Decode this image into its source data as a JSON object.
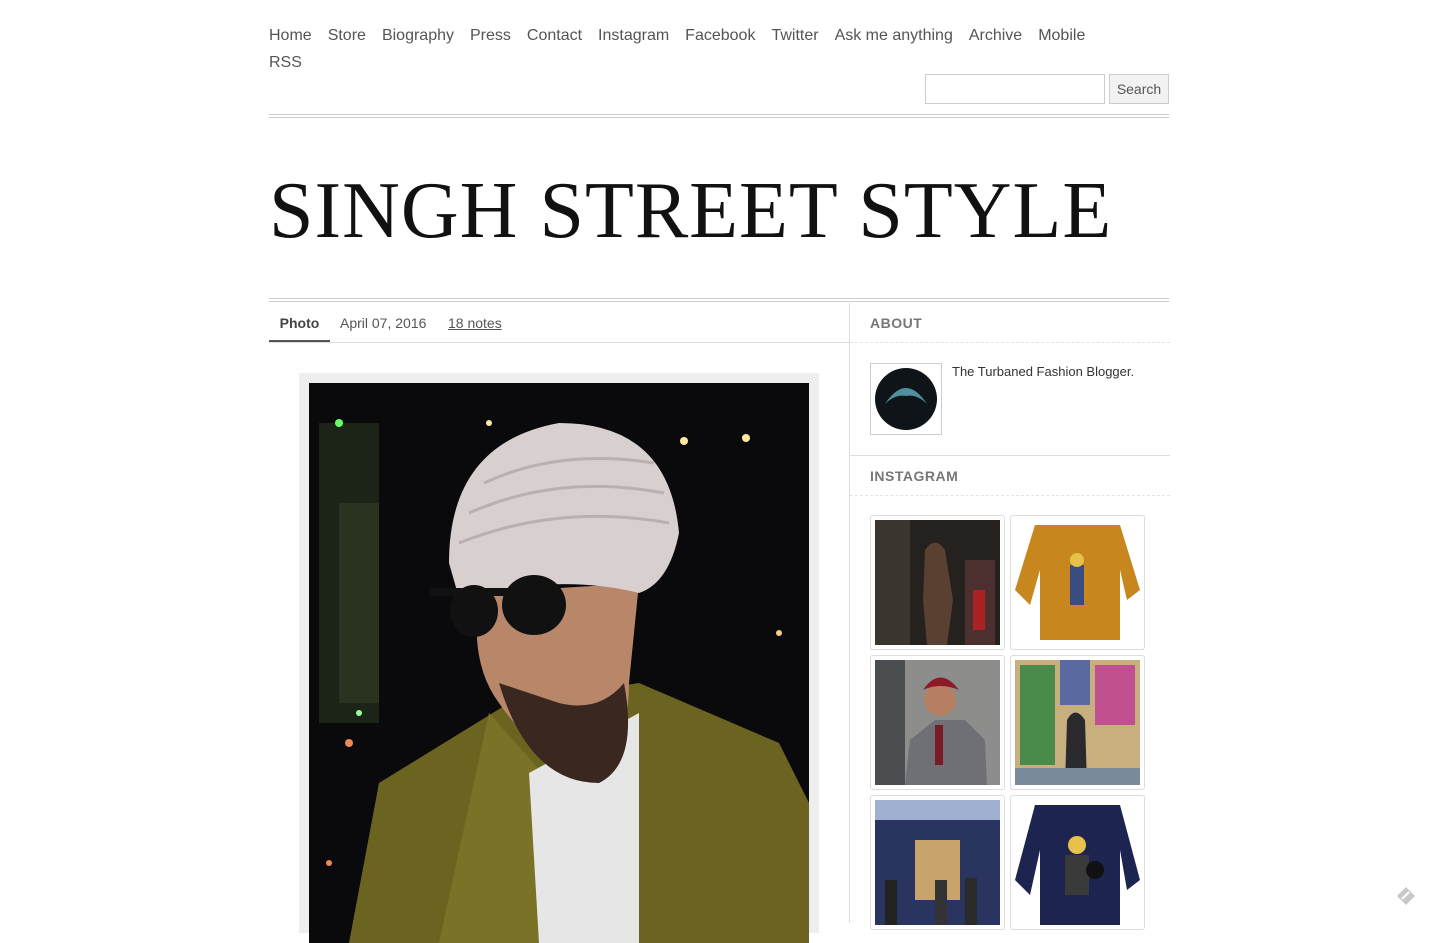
{
  "nav": {
    "items": [
      "Home",
      "Store",
      "Biography",
      "Press",
      "Contact",
      "Instagram",
      "Facebook",
      "Twitter",
      "Ask me anything",
      "Archive",
      "Mobile",
      "RSS"
    ]
  },
  "search": {
    "value": "",
    "button_label": "Search"
  },
  "blog_title": "SINGH STREET STYLE",
  "post": {
    "type": "Photo",
    "date": "April 07, 2016",
    "notes": "18 notes"
  },
  "sidebar": {
    "about_heading": "ABOUT",
    "about_text": "The Turbaned Fashion Blogger.",
    "instagram_heading": "INSTAGRAM"
  },
  "colors": {
    "text": "#444444",
    "title": "#111111",
    "rule": "#cccccc",
    "accent_avatar": "#4f8fa0"
  }
}
